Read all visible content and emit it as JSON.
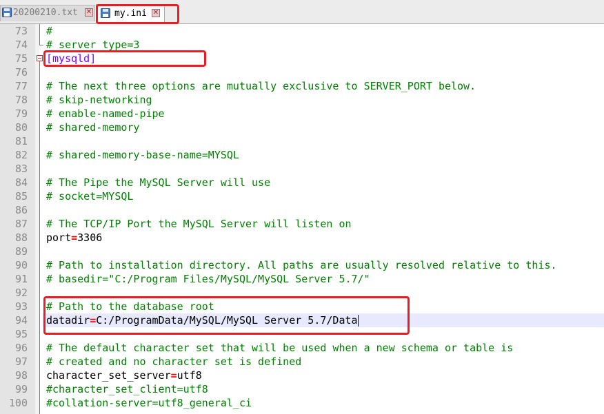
{
  "tabs": [
    {
      "label": "20200210.txt",
      "active": false
    },
    {
      "label": "my.ini",
      "active": true
    }
  ],
  "colors": {
    "comment": "#008000",
    "section": "#8000ff",
    "operator": "#ff0000",
    "highlight": "#ec1c24",
    "current_line": "#e8e8ff"
  },
  "editor": {
    "lines": [
      {
        "num": "73",
        "kind": "comment",
        "text": "#"
      },
      {
        "num": "74",
        "kind": "comment",
        "text": "# server_type=3"
      },
      {
        "num": "75",
        "kind": "section",
        "text": "[mysqld]"
      },
      {
        "num": "76",
        "kind": "blank",
        "text": ""
      },
      {
        "num": "77",
        "kind": "comment",
        "text": "# The next three options are mutually exclusive to SERVER_PORT below."
      },
      {
        "num": "78",
        "kind": "comment",
        "text": "# skip-networking"
      },
      {
        "num": "79",
        "kind": "comment",
        "text": "# enable-named-pipe"
      },
      {
        "num": "80",
        "kind": "comment",
        "text": "# shared-memory"
      },
      {
        "num": "81",
        "kind": "blank",
        "text": ""
      },
      {
        "num": "82",
        "kind": "comment",
        "text": "# shared-memory-base-name=MYSQL"
      },
      {
        "num": "83",
        "kind": "blank",
        "text": ""
      },
      {
        "num": "84",
        "kind": "comment",
        "text": "# The Pipe the MySQL Server will use"
      },
      {
        "num": "85",
        "kind": "comment",
        "text": "# socket=MYSQL"
      },
      {
        "num": "86",
        "kind": "blank",
        "text": ""
      },
      {
        "num": "87",
        "kind": "comment",
        "text": "# The TCP/IP Port the MySQL Server will listen on"
      },
      {
        "num": "88",
        "kind": "kv",
        "key": "port",
        "op": "=",
        "value": "3306"
      },
      {
        "num": "89",
        "kind": "blank",
        "text": ""
      },
      {
        "num": "90",
        "kind": "comment",
        "text": "# Path to installation directory. All paths are usually resolved relative to this."
      },
      {
        "num": "91",
        "kind": "comment",
        "text": "# basedir=\"C:/Program Files/MySQL/MySQL Server 5.7/\""
      },
      {
        "num": "92",
        "kind": "blank",
        "text": ""
      },
      {
        "num": "93",
        "kind": "comment",
        "text": "# Path to the database root"
      },
      {
        "num": "94",
        "kind": "kv",
        "key": "datadir",
        "op": "=",
        "value": "C:/ProgramData/MySQL/MySQL Server 5.7/Data",
        "current": true
      },
      {
        "num": "95",
        "kind": "blank",
        "text": ""
      },
      {
        "num": "96",
        "kind": "comment",
        "text": "# The default character set that will be used when a new schema or table is"
      },
      {
        "num": "97",
        "kind": "comment",
        "text": "# created and no character set is defined"
      },
      {
        "num": "98",
        "kind": "kv",
        "key": "character_set_server",
        "op": "=",
        "value": "utf8"
      },
      {
        "num": "99",
        "kind": "comment",
        "text": "#character_set_client=utf8"
      },
      {
        "num": "100",
        "kind": "comment",
        "text": "#collation-server=utf8_general_ci"
      }
    ]
  }
}
